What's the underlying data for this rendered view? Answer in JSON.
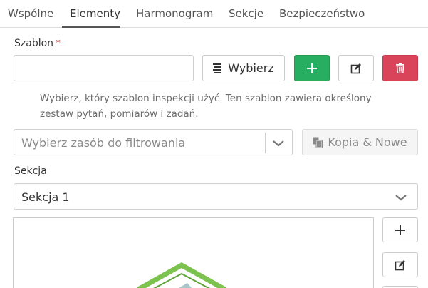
{
  "tabs": [
    {
      "label": "Wspólne"
    },
    {
      "label": "Elementy"
    },
    {
      "label": "Harmonogram"
    },
    {
      "label": "Sekcje"
    },
    {
      "label": "Bezpieczeństwo"
    }
  ],
  "active_tab": "Elementy",
  "template": {
    "label": "Szablon",
    "required_mark": "*",
    "value": "",
    "choose_label": "Wybierz",
    "help": "Wybierz, który szablon inspekcji użyć. Ten szablon zawiera określony zestaw pytań, pomiarów i zadań."
  },
  "resource_filter": {
    "placeholder": "Wybierz zasób do filtrowania",
    "copy_new_label": "Kopia & Nowe"
  },
  "section": {
    "label": "Sekcja",
    "value": "Sekcja 1"
  },
  "colors": {
    "green": "#27ae60",
    "red": "#d9445a",
    "required": "#d9534f"
  }
}
